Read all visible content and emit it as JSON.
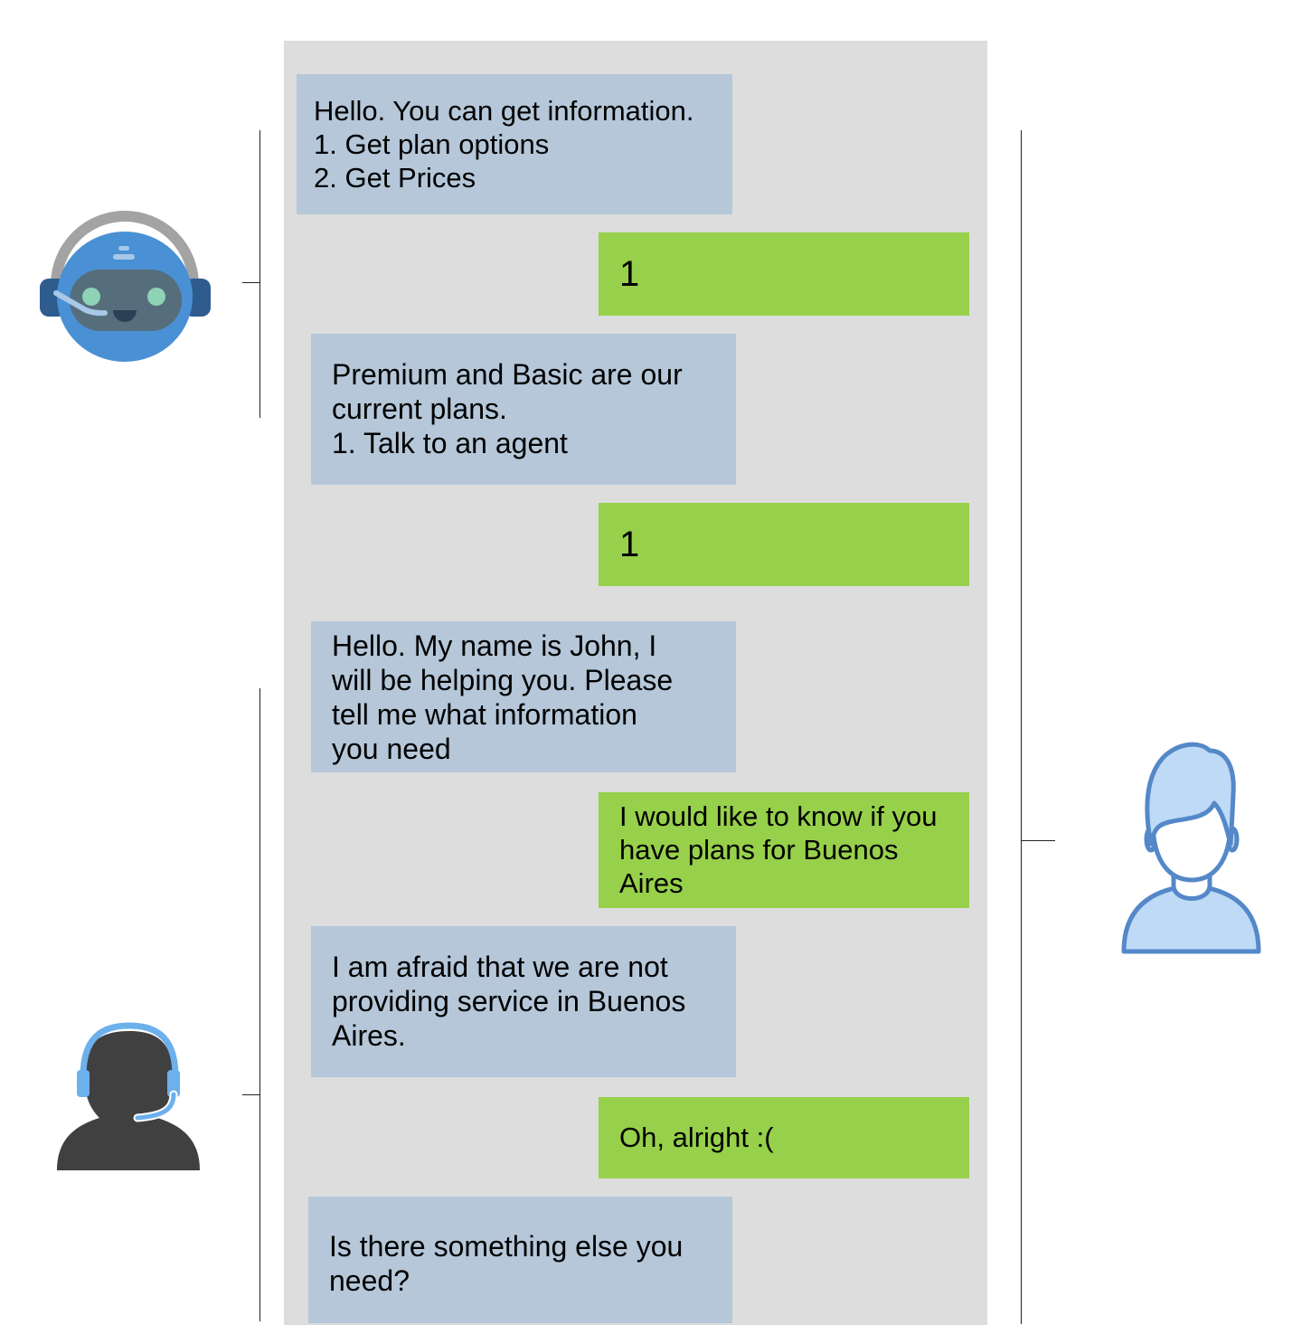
{
  "participants": {
    "bot": {
      "label": "chatbot",
      "icon": "robot-headset-icon"
    },
    "agent": {
      "label": "human agent",
      "icon": "agent-headset-icon"
    },
    "customer": {
      "label": "customer",
      "icon": "user-avatar-icon"
    }
  },
  "colors": {
    "panel": "#dddddd",
    "bot_bubble": "#b5c7d9",
    "user_bubble": "#97d04a"
  },
  "messages": [
    {
      "sender": "bot",
      "text": "Hello. You can get information.\n1. Get plan options\n2. Get Prices"
    },
    {
      "sender": "customer",
      "text": "1"
    },
    {
      "sender": "bot",
      "text": "Premium and Basic are our\ncurrent plans.\n1. Talk to an agent"
    },
    {
      "sender": "customer",
      "text": "1"
    },
    {
      "sender": "agent",
      "text": "Hello. My name is John, I\nwill be helping you. Please\ntell me what information\nyou need"
    },
    {
      "sender": "customer",
      "text": "I would like to know if you\nhave plans for Buenos\nAires"
    },
    {
      "sender": "agent",
      "text": "I am afraid that we are not\nproviding service in Buenos\nAires."
    },
    {
      "sender": "customer",
      "text": "Oh, alright :("
    },
    {
      "sender": "agent",
      "text": "Is there something else you\nneed?"
    }
  ]
}
